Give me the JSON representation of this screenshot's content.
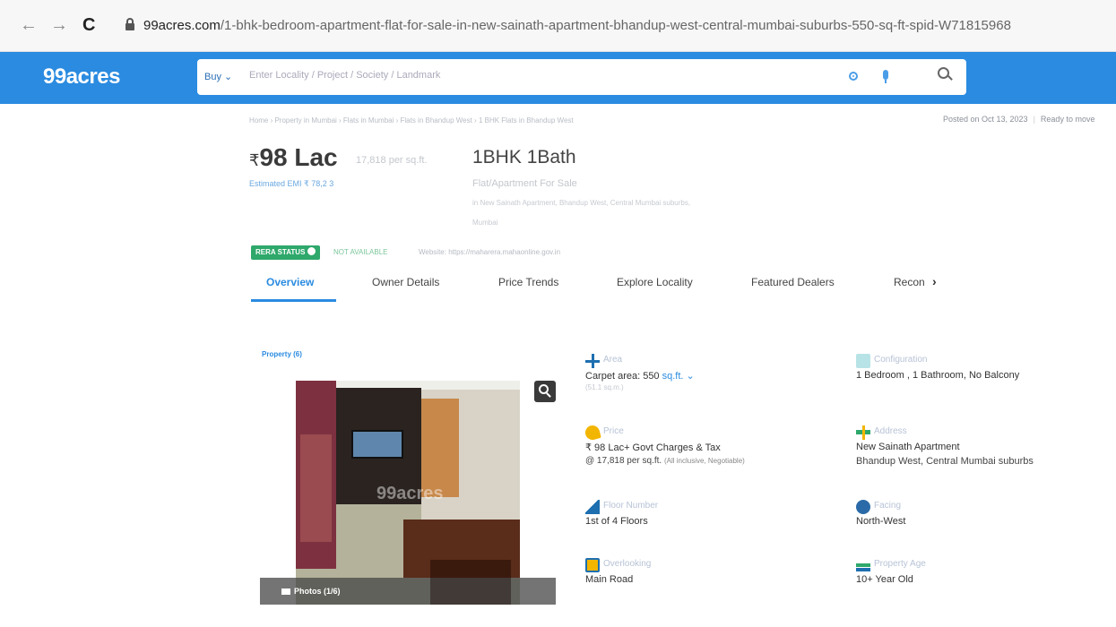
{
  "browser": {
    "back": "←",
    "forward": "→",
    "reload": "C",
    "url_host": "99acres.com",
    "url_path": "/1-bhk-bedroom-apartment-flat-for-sale-in-new-sainath-apartment-bhandup-west-central-mumbai-suburbs-550-sq-ft-spid-W71815968"
  },
  "header": {
    "logo": "99acres",
    "buy_label": "Buy ⌄",
    "search_placeholder": "Enter Locality / Project / Society / Landmark"
  },
  "breadcrumb": "Home › Property in Mumbai › Flats in Mumbai › Flats in Bhandup West › 1 BHK Flats in Bhandup West",
  "posted": {
    "date": "Posted on Oct 13, 2023",
    "status": "Ready to move"
  },
  "listing": {
    "currency": "₹",
    "price": "98 Lac",
    "per_sqft": "17,818 per sq.ft.",
    "emi": "Estimated EMI ₹ 78,2 3",
    "bhk": "1BHK 1Bath",
    "property_type": "Flat/Apartment For Sale",
    "location_line1": "in New Sainath Apartment, Bhandup West, Central Mumbai suburbs,",
    "location_line2": "Mumbai"
  },
  "rera": {
    "label": "RERA STATUS",
    "status": "NOT AVAILABLE",
    "website": "Website: https://maharera.mahaonline.gov.in"
  },
  "tabs": [
    {
      "label": "Overview",
      "active": true
    },
    {
      "label": "Owner Details",
      "active": false
    },
    {
      "label": "Price Trends",
      "active": false
    },
    {
      "label": "Explore Locality",
      "active": false
    },
    {
      "label": "Featured Dealers",
      "active": false
    },
    {
      "label": "Recon",
      "active": false
    }
  ],
  "tab_more": "›",
  "photos": {
    "title": "Property (6)",
    "watermark": "99acres",
    "label": "Photos (1/6)"
  },
  "attributes": {
    "area": {
      "label": "Area",
      "value_prefix": "Carpet area: 550 ",
      "unit": "sq.ft. ⌄",
      "sub": "(51.1 sq.m.)"
    },
    "configuration": {
      "label": "Configuration",
      "value": "1 Bedroom , 1 Bathroom, No Balcony"
    },
    "price": {
      "label": "Price",
      "value": "₹ 98 Lac+ Govt Charges & Tax",
      "line2": "@ 17,818 per sq.ft.",
      "line2_sub": "(All inclusive, Negotiable)"
    },
    "address": {
      "label": "Address",
      "value": "New Sainath Apartment",
      "line2": "Bhandup West, Central Mumbai suburbs"
    },
    "floor": {
      "label": "Floor Number",
      "value": "1st of 4 Floors"
    },
    "facing": {
      "label": "Facing",
      "value": "North-West"
    },
    "overlooking": {
      "label": "Overlooking",
      "value": "Main Road"
    },
    "age": {
      "label": "Property Age",
      "value": "10+ Year Old"
    }
  },
  "colors": {
    "header_blue": "#2a8be0",
    "rera_green": "#2ea86b",
    "link_blue": "#2a8be0"
  }
}
